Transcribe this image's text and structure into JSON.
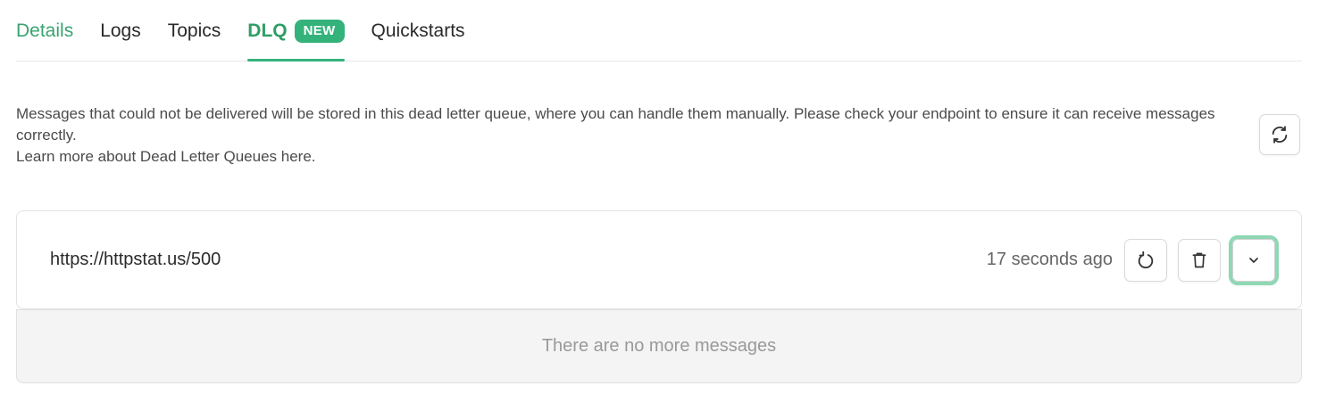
{
  "tabs": [
    {
      "label": "Details"
    },
    {
      "label": "Logs"
    },
    {
      "label": "Topics"
    },
    {
      "label": "DLQ",
      "badge": "NEW"
    },
    {
      "label": "Quickstarts"
    }
  ],
  "description": {
    "line1": "Messages that could not be delivered will be stored in this dead letter queue, where you can handle them manually. Please check your endpoint to ensure it can receive messages correctly.",
    "line2": "Learn more about Dead Letter Queues here."
  },
  "message": {
    "url": "https://httpstat.us/500",
    "time": "17 seconds ago"
  },
  "empty_state": "There are no more messages",
  "icons": {
    "refresh": "refresh-icon",
    "retry": "retry-icon",
    "delete": "trash-icon",
    "expand": "chevron-down-icon"
  },
  "colors": {
    "accent": "#34b27b",
    "focus_ring": "#8ed8b4"
  }
}
